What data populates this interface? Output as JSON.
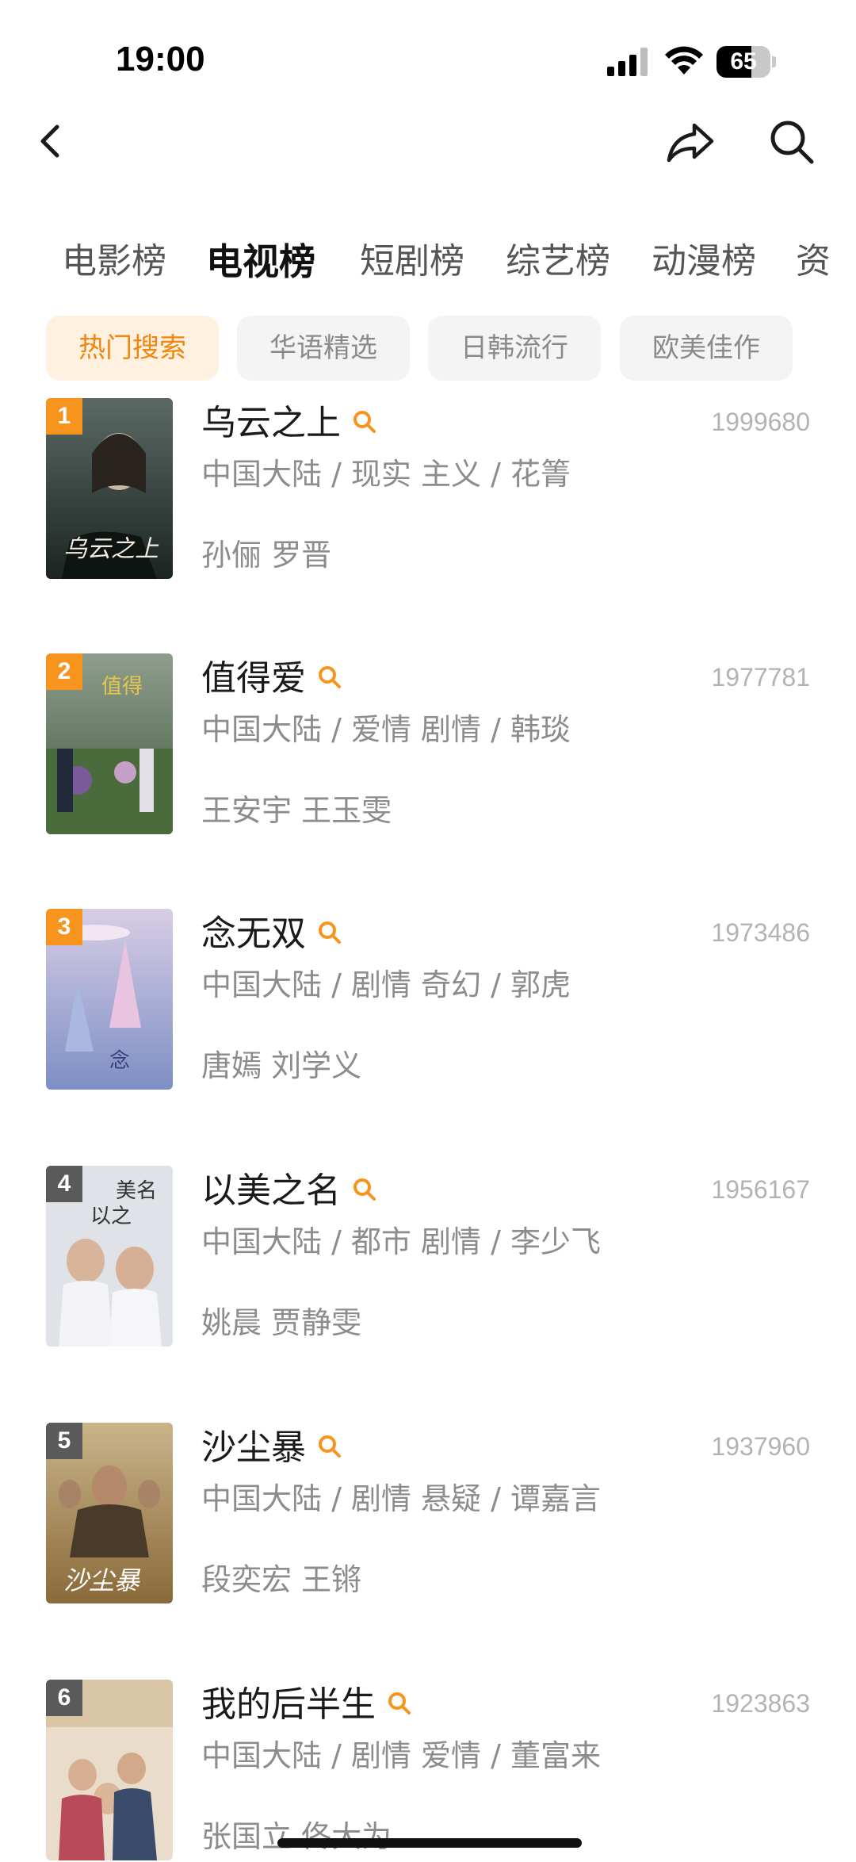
{
  "status_bar": {
    "time": "19:00",
    "battery": "65",
    "battery_level": 0.65
  },
  "nav": {
    "back_icon": "chevron-left-icon",
    "share_icon": "share-arrow-icon",
    "search_icon": "search-icon"
  },
  "categories": [
    {
      "label": "电影榜"
    },
    {
      "label": "电视榜",
      "active": true
    },
    {
      "label": "短剧榜"
    },
    {
      "label": "综艺榜"
    },
    {
      "label": "动漫榜"
    },
    {
      "label": "资"
    }
  ],
  "chips": [
    {
      "label": "热门搜索",
      "active": true
    },
    {
      "label": "华语精选"
    },
    {
      "label": "日韩流行"
    },
    {
      "label": "欧美佳作"
    }
  ],
  "colors": {
    "accent": "#f7941d",
    "chip_active_bg": "#fff1e0",
    "chip_active_text": "#f0860f",
    "rank_top": "#f7941d",
    "rank_normal": "#5a5a5a"
  },
  "items": [
    {
      "rank": "1",
      "title": "乌云之上",
      "score": "1999680",
      "meta": "中国大陆 / 现实 主义 / 花箐",
      "cast": "孙俪 罗晋"
    },
    {
      "rank": "2",
      "title": "值得爱",
      "score": "1977781",
      "meta": "中国大陆 / 爱情 剧情 / 韩琰",
      "cast": "王安宇 王玉雯"
    },
    {
      "rank": "3",
      "title": "念无双",
      "score": "1973486",
      "meta": "中国大陆 / 剧情 奇幻 / 郭虎",
      "cast": "唐嫣 刘学义"
    },
    {
      "rank": "4",
      "title": "以美之名",
      "score": "1956167",
      "meta": "中国大陆 / 都市 剧情 / 李少飞",
      "cast": "姚晨 贾静雯"
    },
    {
      "rank": "5",
      "title": "沙尘暴",
      "score": "1937960",
      "meta": "中国大陆 / 剧情 悬疑 / 谭嘉言",
      "cast": "段奕宏 王锵"
    },
    {
      "rank": "6",
      "title": "我的后半生",
      "score": "1923863",
      "meta": "中国大陆 / 剧情 爱情 / 董富来",
      "cast": "张国立 佟大为"
    }
  ]
}
